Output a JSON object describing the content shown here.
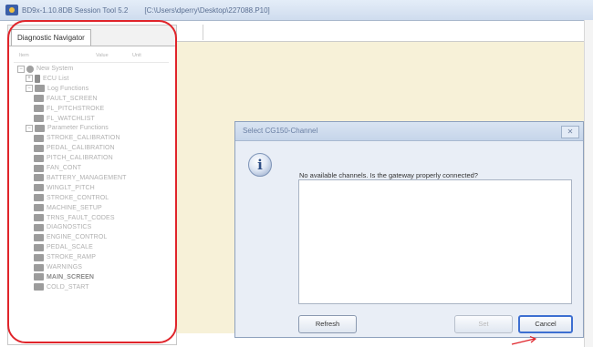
{
  "window": {
    "title": "BD9x-1.10.8DB Session Tool 5.2",
    "path": "[C:\\Users\\dperry\\Desktop\\227088.P10]"
  },
  "navigator": {
    "tab_label": "Diagnostic Navigator",
    "columns": [
      "Item",
      "Value",
      "Unit"
    ],
    "items": [
      {
        "label": "New System",
        "depth": 0,
        "expander": "−",
        "icon": "sys"
      },
      {
        "label": "ECU List",
        "depth": 1,
        "expander": "+",
        "icon": "ecu"
      },
      {
        "label": "Log Functions",
        "depth": 1,
        "expander": "−",
        "icon": "folder"
      },
      {
        "label": "FAULT_SCREEN",
        "depth": 2,
        "icon": "folder"
      },
      {
        "label": "FL_PITCHSTROKE",
        "depth": 2,
        "icon": "folder"
      },
      {
        "label": "FL_WATCHLIST",
        "depth": 2,
        "icon": "folder"
      },
      {
        "label": "Parameter Functions",
        "depth": 1,
        "expander": "−",
        "icon": "folder"
      },
      {
        "label": "STROKE_CALIBRATION",
        "depth": 2,
        "icon": "folder"
      },
      {
        "label": "PEDAL_CALIBRATION",
        "depth": 2,
        "icon": "folder"
      },
      {
        "label": "PITCH_CALIBRATION",
        "depth": 2,
        "icon": "folder"
      },
      {
        "label": "FAN_CONT",
        "depth": 2,
        "icon": "folder"
      },
      {
        "label": "BATTERY_MANAGEMENT",
        "depth": 2,
        "icon": "folder"
      },
      {
        "label": "WINGLT_PITCH",
        "depth": 2,
        "icon": "folder"
      },
      {
        "label": "STROKE_CONTROL",
        "depth": 2,
        "icon": "folder"
      },
      {
        "label": "MACHINE_SETUP",
        "depth": 2,
        "icon": "folder"
      },
      {
        "label": "TRNS_FAULT_CODES",
        "depth": 2,
        "icon": "folder"
      },
      {
        "label": "DIAGNOSTICS",
        "depth": 2,
        "icon": "folder"
      },
      {
        "label": "ENGINE_CONTROL",
        "depth": 2,
        "icon": "folder"
      },
      {
        "label": "PEDAL_SCALE",
        "depth": 2,
        "icon": "folder"
      },
      {
        "label": "STROKE_RAMP",
        "depth": 2,
        "icon": "folder"
      },
      {
        "label": "WARNINGS",
        "depth": 2,
        "icon": "folder"
      },
      {
        "label": "MAIN_SCREEN",
        "depth": 2,
        "icon": "folder",
        "strong": true
      },
      {
        "label": "COLD_START",
        "depth": 2,
        "icon": "folder"
      }
    ]
  },
  "dialog": {
    "title": "Select CG150-Channel",
    "close_glyph": "✕",
    "info_glyph": "i",
    "message": "No available channels. Is the gateway properly connected?",
    "buttons": {
      "refresh": "Refresh",
      "set": "Set",
      "cancel": "Cancel"
    }
  },
  "colors": {
    "highlight": "#e0242a",
    "workspace_bg": "#f7f1d8",
    "focus_border": "#3d6fd1"
  }
}
